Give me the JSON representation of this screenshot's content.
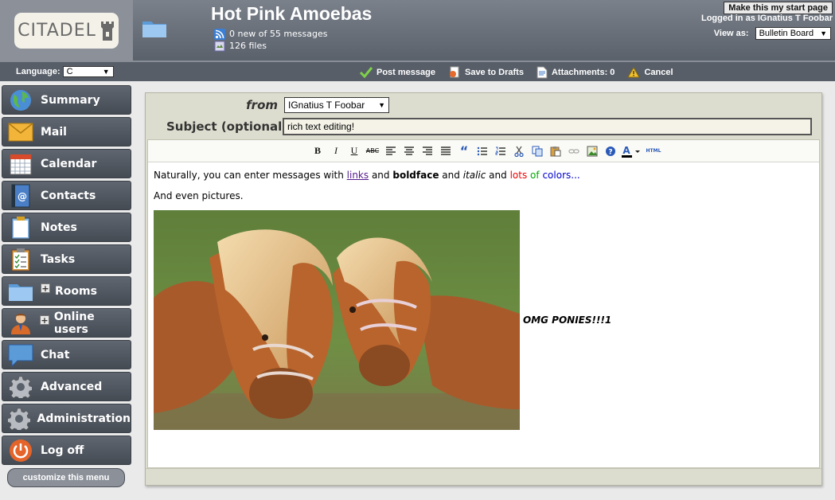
{
  "header": {
    "logo_text": "CITADEL",
    "room_title": "Hot Pink Amoebas",
    "messages_info": "0 new of 55 messages",
    "files_info": "126 files",
    "start_page_button": "Make this my start page",
    "logged_in": "Logged in as IGnatius T Foobar",
    "view_as_label": "View as:",
    "view_as_value": "Bulletin Board"
  },
  "toolbar": {
    "language_label": "Language:",
    "language_value": "C",
    "post_message": "Post message",
    "save_drafts": "Save to Drafts",
    "attachments": "Attachments: 0",
    "cancel": "Cancel"
  },
  "sidebar": {
    "items": [
      {
        "label": "Summary",
        "icon": "globe-icon"
      },
      {
        "label": "Mail",
        "icon": "envelope-icon"
      },
      {
        "label": "Calendar",
        "icon": "calendar-icon"
      },
      {
        "label": "Contacts",
        "icon": "address-book-icon"
      },
      {
        "label": "Notes",
        "icon": "notepad-icon"
      },
      {
        "label": "Tasks",
        "icon": "checklist-icon"
      },
      {
        "label": "Rooms",
        "icon": "folder-icon"
      },
      {
        "label": "Online users",
        "icon": "user-icon"
      },
      {
        "label": "Chat",
        "icon": "chat-bubble-icon"
      },
      {
        "label": "Advanced",
        "icon": "gear-icon"
      },
      {
        "label": "Administration",
        "icon": "gear-icon"
      },
      {
        "label": "Log off",
        "icon": "power-icon"
      }
    ],
    "customize": "customize this menu"
  },
  "compose": {
    "from_label": "from",
    "from_value": "IGnatius T Foobar",
    "subject_label": "Subject (optional):",
    "subject_value": "rich text editing!",
    "body": {
      "t1": "Naturally, you can enter messages with ",
      "link": "links",
      "t2": " and ",
      "bold": "boldface",
      "t3": " and ",
      "italic": "italic",
      "t4": " and ",
      "lots": "lots",
      "of": "of",
      "colors": "colors...",
      "line2": "And even pictures.",
      "caption": "OMG PONIES!!!1"
    },
    "rte": {
      "bold": "B",
      "italic": "I",
      "underline": "U",
      "strike": "ABC",
      "quote": "“",
      "html": "HTML"
    }
  }
}
